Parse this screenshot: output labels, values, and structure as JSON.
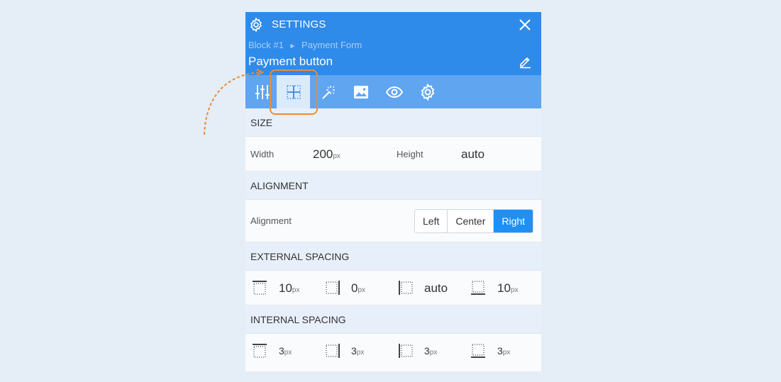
{
  "header": {
    "title": "SETTINGS",
    "breadcrumb_block": "Block #1",
    "breadcrumb_sep": "►",
    "breadcrumb_form": "Payment Form",
    "block_title": "Payment button"
  },
  "tabs": [
    {
      "icon": "sliders-icon"
    },
    {
      "icon": "layout-grid-icon",
      "active": true
    },
    {
      "icon": "magic-wand-icon"
    },
    {
      "icon": "image-icon"
    },
    {
      "icon": "eye-icon"
    },
    {
      "icon": "gear-icon"
    }
  ],
  "size": {
    "heading": "SIZE",
    "width_label": "Width",
    "width_value": "200",
    "width_unit": "px",
    "height_label": "Height",
    "height_value": "auto"
  },
  "alignment": {
    "heading": "ALIGNMENT",
    "label": "Alignment",
    "options": [
      "Left",
      "Center",
      "Right"
    ],
    "selected": "Right"
  },
  "external_spacing": {
    "heading": "EXTERNAL SPACING",
    "top": {
      "value": "10",
      "unit": "px"
    },
    "right": {
      "value": "0",
      "unit": "px"
    },
    "left": {
      "value": "auto",
      "unit": ""
    },
    "bottom": {
      "value": "10",
      "unit": "px"
    }
  },
  "internal_spacing": {
    "heading": "INTERNAL SPACING",
    "top": {
      "value": "3",
      "unit": "px"
    },
    "right": {
      "value": "3",
      "unit": "px"
    },
    "left": {
      "value": "3",
      "unit": "px"
    },
    "bottom": {
      "value": "3",
      "unit": "px"
    }
  },
  "colors": {
    "header": "#2f8bea",
    "tabbar": "#60a5f0",
    "active_tab": "#dcebfc",
    "accent": "#1e90f5",
    "highlight": "#e98b3a",
    "background": "#e5edf6"
  }
}
